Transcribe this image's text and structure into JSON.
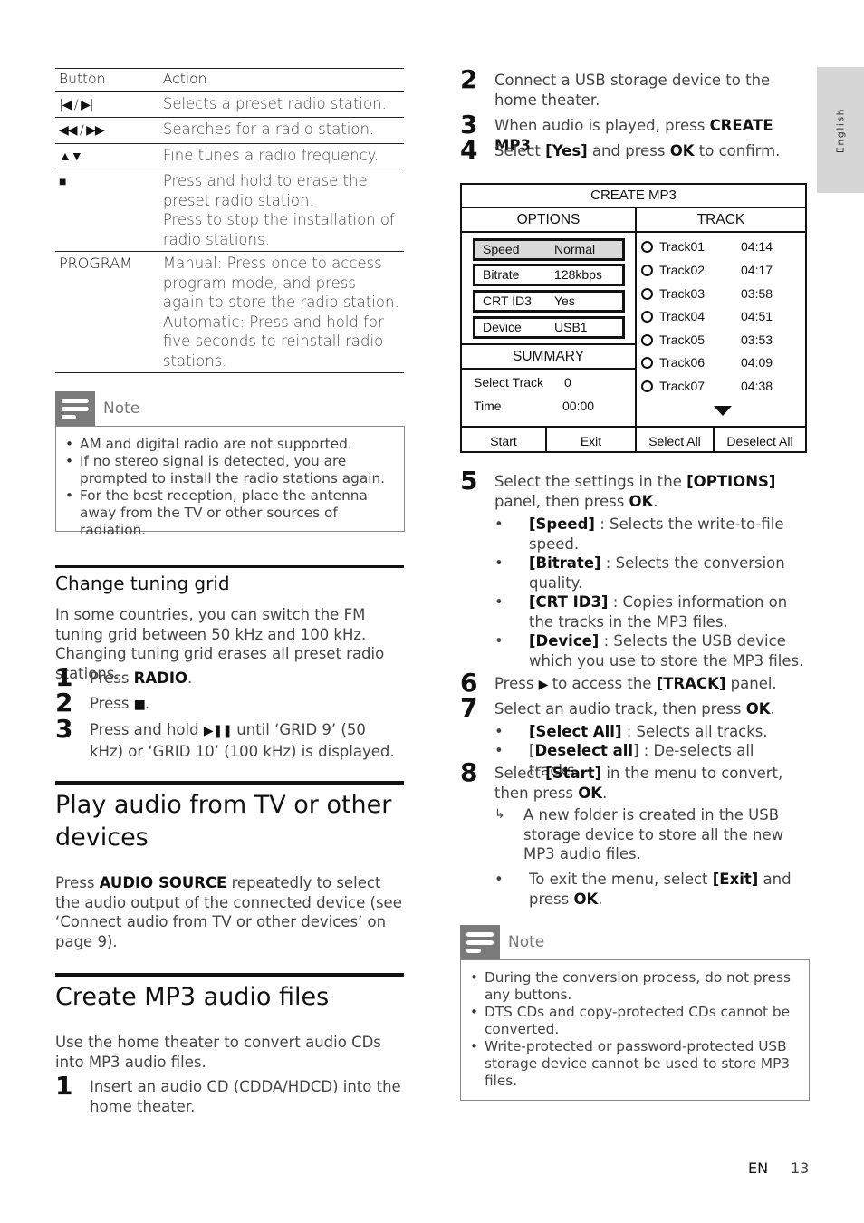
{
  "side_tab": {
    "label": "English"
  },
  "button_table": {
    "headers": [
      "Button",
      "Action"
    ],
    "rows": [
      {
        "button_icon": "previous-next-icon",
        "button": "|◀ / ▶|",
        "action": "Selects a preset radio station."
      },
      {
        "button_icon": "rewind-fastforward-icon",
        "button": "◀◀ / ▶▶",
        "action": "Searches for a radio station."
      },
      {
        "button_icon": "up-down-icon",
        "button": "▲▼",
        "action": "Fine tunes a radio frequency."
      },
      {
        "button_icon": "stop-icon",
        "button": "■",
        "action": "Press and hold to erase the preset radio station.\nPress to stop the installation of radio stations."
      },
      {
        "button_icon": "",
        "button": "PROGRAM",
        "action": "Manual: Press once to access program mode, and press again to store the radio station.\nAutomatic: Press and hold for five seconds to reinstall radio stations."
      }
    ]
  },
  "note1": {
    "label": "Note",
    "items": [
      "AM and digital radio are not supported.",
      "If no stereo signal is detected, you are prompted to install the radio stations again.",
      "For the best reception, place the antenna away from the TV or other sources of radiation."
    ]
  },
  "tuning": {
    "heading": "Change tuning grid",
    "intro": "In some countries, you can switch the FM tuning grid between 50 kHz and 100 kHz. Changing tuning grid erases all preset radio stations.",
    "steps": [
      {
        "n": "1",
        "pre": "Press ",
        "bold": "RADIO",
        "post": "."
      },
      {
        "n": "2",
        "pre": "Press ",
        "icon": "stop-icon",
        "glyph": "■",
        "post": "."
      },
      {
        "n": "3",
        "pre": "Press and hold ",
        "icon": "play-pause-icon",
        "glyph": "▶❚❚",
        "post": " until ‘GRID 9’ (50 kHz) or ‘GRID 10’ (100 kHz) is displayed."
      }
    ]
  },
  "play_audio": {
    "heading": "Play audio from TV or other devices",
    "pre": "Press ",
    "bold": "AUDIO SOURCE",
    "post": " repeatedly to select the audio output of the connected device (see ‘Connect audio from TV or other devices’ on page 9)."
  },
  "create_mp3": {
    "heading": "Create MP3 audio files",
    "intro": "Use the home theater to convert audio CDs into MP3 audio files.",
    "steps": {
      "s1": {
        "n": "1",
        "text": "Insert an audio CD (CDDA/HDCD) into the home theater."
      },
      "s2": {
        "n": "2",
        "text": "Connect a USB storage device to the home theater."
      },
      "s3": {
        "n": "3",
        "pre": "When audio is played, press ",
        "bold": "CREATE MP3",
        "post": "."
      },
      "s4": {
        "n": "4",
        "pre": "Select ",
        "bold1": "[Yes]",
        "mid": " and press ",
        "bold2": "OK",
        "post": " to confirm."
      },
      "s5": {
        "n": "5",
        "pre": "Select the settings in the ",
        "bold1": "[OPTIONS]",
        "mid": " panel, then press ",
        "bold2": "OK",
        "post": ".",
        "bullets": [
          {
            "bold": "[Speed]",
            "text": " : Selects the write-to-file speed."
          },
          {
            "bold": "[Bitrate]",
            "text": " : Selects the conversion quality."
          },
          {
            "bold": "[CRT ID3]",
            "text": " : Copies information on the tracks in the MP3 files."
          },
          {
            "bold": "[Device]",
            "text": " : Selects the USB device which you use to store the MP3 files."
          }
        ]
      },
      "s6": {
        "n": "6",
        "pre": "Press ",
        "glyph": "▶",
        "mid": " to access the ",
        "bold": "[TRACK]",
        "post": " panel."
      },
      "s7": {
        "n": "7",
        "pre": "Select an audio track, then press ",
        "bold": "OK",
        "post": ".",
        "bullets": [
          {
            "open": "",
            "bold": "[Select All]",
            "text": " : Selects all tracks."
          },
          {
            "open": "[",
            "bold": "Deselect all",
            "text": "] : De-selects all tracks."
          }
        ]
      },
      "s8": {
        "n": "8",
        "pre": "Select ",
        "bold1": "[Start]",
        "mid": " in the menu to convert, then press ",
        "bold2": "OK",
        "post": ".",
        "result": "A new folder is created in the USB storage device to store all the new MP3 audio files.",
        "exit_pre": "To exit the menu, select ",
        "exit_bold1": "[Exit]",
        "exit_mid": " and press ",
        "exit_bold2": "OK",
        "exit_post": "."
      }
    }
  },
  "mp3_screen": {
    "title": "CREATE MP3",
    "options_header": "OPTIONS",
    "track_header": "TRACK",
    "options": [
      {
        "key": "Speed",
        "value": "Normal",
        "selected": true
      },
      {
        "key": "Bitrate",
        "value": "128kbps",
        "selected": false
      },
      {
        "key": "CRT ID3",
        "value": "Yes",
        "selected": false
      },
      {
        "key": "Device",
        "value": "USB1",
        "selected": false
      }
    ],
    "summary_header": "SUMMARY",
    "summary": [
      {
        "key": "Select Track",
        "value": "0"
      },
      {
        "key": "Time",
        "value": "00:00"
      }
    ],
    "tracks": [
      {
        "name": "Track01",
        "time": "04:14"
      },
      {
        "name": "Track02",
        "time": "04:17"
      },
      {
        "name": "Track03",
        "time": "03:58"
      },
      {
        "name": "Track04",
        "time": "04:51"
      },
      {
        "name": "Track05",
        "time": "03:53"
      },
      {
        "name": "Track06",
        "time": "04:09"
      },
      {
        "name": "Track07",
        "time": "04:38"
      }
    ],
    "buttons": [
      "Start",
      "Exit",
      "Select All",
      "Deselect All"
    ]
  },
  "note2": {
    "label": "Note",
    "items": [
      "During the conversion process, do not press any buttons.",
      "DTS CDs and copy-protected CDs cannot be converted.",
      "Write-protected or password-protected USB storage device cannot be used to store MP3 files."
    ]
  },
  "footer": {
    "lang": "EN",
    "page": "13"
  }
}
